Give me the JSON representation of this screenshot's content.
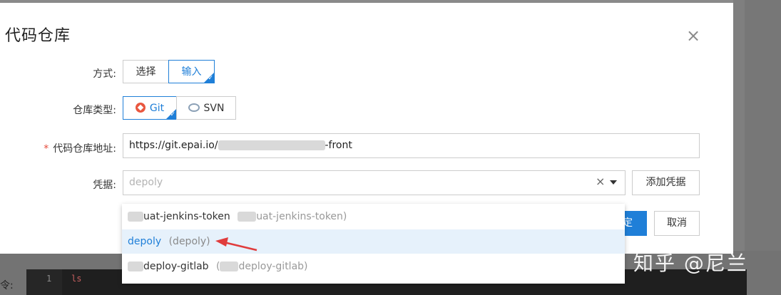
{
  "modal": {
    "title": "代码仓库",
    "close_glyph": "×"
  },
  "form": {
    "method": {
      "label": "方式:",
      "options": [
        "选择",
        "输入"
      ],
      "selected": "输入"
    },
    "repo_type": {
      "label": "仓库类型:",
      "options": [
        {
          "label": "Git",
          "icon": "git-icon"
        },
        {
          "label": "SVN",
          "icon": "svn-icon"
        }
      ],
      "selected": "Git"
    },
    "repo_url": {
      "required_mark": "*",
      "label": "代码仓库地址:",
      "value_prefix": "https://git.epai.io/",
      "value_suffix": "-front"
    },
    "credential": {
      "label": "凭据:",
      "placeholder": "depoly",
      "clear_glyph": "×",
      "add_button": "添加凭据"
    }
  },
  "footer": {
    "confirm_label_visible": "定",
    "cancel_label": "取消"
  },
  "dropdown": {
    "items": [
      {
        "main": "uat-jenkins-token",
        "sub": "uat-jenkins-token)",
        "highlighted": false
      },
      {
        "main": "depoly",
        "sub": "(depoly)",
        "highlighted": true
      },
      {
        "main": "deploy-gitlab",
        "sub": "deploy-gitlab)",
        "highlighted": false
      }
    ]
  },
  "editor": {
    "cmd_label": "令:",
    "line_number": "1",
    "code": "ls"
  },
  "watermark": "知乎 @尼兰",
  "colors": {
    "accent": "#1f7fd8",
    "required": "#e64a3b",
    "annotation_arrow": "#e03c3c"
  }
}
